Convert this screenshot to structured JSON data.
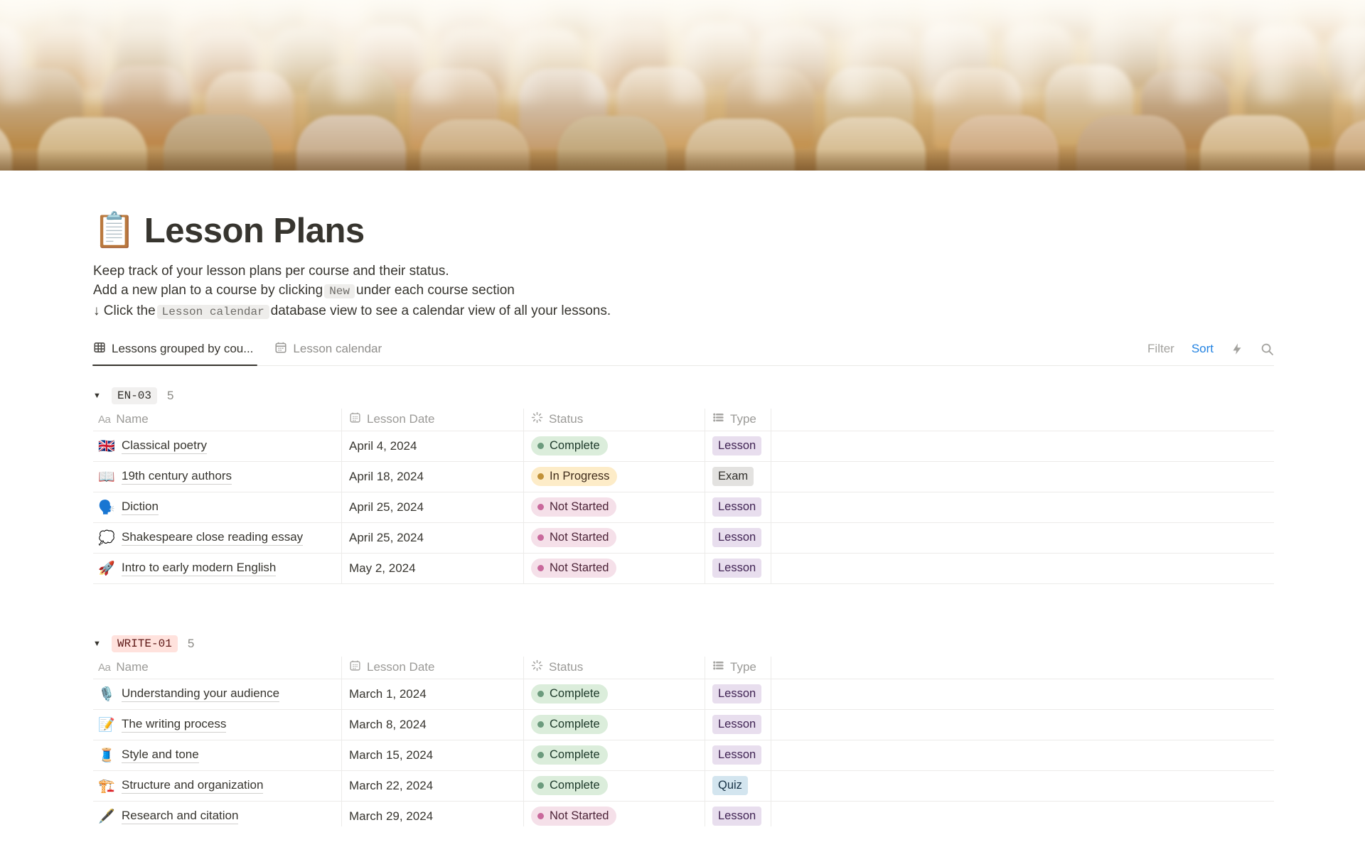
{
  "page": {
    "icon": "📋",
    "icon_name": "clipboard-emoji",
    "title": "Lesson Plans",
    "description_line1": "Keep track of your lesson plans per course and their status.",
    "description_line2_prefix": "Add a new plan to a course by clicking",
    "description_line2_code": "New",
    "description_line2_suffix": "under each course section",
    "description_line3_prefix": "↓ Click the",
    "description_line3_code": "Lesson calendar",
    "description_line3_suffix": "database view to see a calendar view of all your lessons."
  },
  "toolbar": {
    "tabs": [
      {
        "label": "Lessons grouped by cou...",
        "icon": "table-view-icon",
        "active": true
      },
      {
        "label": "Lesson calendar",
        "icon": "calendar-view-icon",
        "active": false
      }
    ],
    "filter_label": "Filter",
    "sort_label": "Sort",
    "sort_color": "#2383E2"
  },
  "table": {
    "columns": [
      {
        "id": "name",
        "label": "Name",
        "icon": "text-property-icon"
      },
      {
        "id": "date",
        "label": "Lesson Date",
        "icon": "calendar-icon"
      },
      {
        "id": "status",
        "label": "Status",
        "icon": "status-property-icon"
      },
      {
        "id": "type",
        "label": "Type",
        "icon": "select-property-icon"
      }
    ]
  },
  "status_colors": {
    "Complete": {
      "bg": "#DBEDDB",
      "dot": "#6C9B7D",
      "text": "#1C3829"
    },
    "In Progress": {
      "bg": "#FDECC8",
      "dot": "#C19138",
      "text": "#402C1B"
    },
    "Not Started": {
      "bg": "#F5E0E9",
      "dot": "#C9699C",
      "text": "#4C2337"
    }
  },
  "type_colors": {
    "Lesson": {
      "bg": "#E8DEEE",
      "text": "#412454"
    },
    "Exam": {
      "bg": "#E3E2E0",
      "text": "#32302C"
    },
    "Quiz": {
      "bg": "#D3E5EF",
      "text": "#183347"
    }
  },
  "groups": [
    {
      "name": "EN-03",
      "count": "5",
      "badge_bg": "#F1F0EF",
      "badge_text_color": "#32302C",
      "rows": [
        {
          "icon": "🇬🇧",
          "icon_name": "uk-flag-emoji",
          "name": "Classical poetry",
          "date": "April 4, 2024",
          "status": "Complete",
          "type": "Lesson"
        },
        {
          "icon": "📖",
          "icon_name": "open-book-emoji",
          "name": "19th century authors",
          "date": "April 18, 2024",
          "status": "In Progress",
          "type": "Exam"
        },
        {
          "icon": "🗣️",
          "icon_name": "speaking-head-emoji",
          "name": "Diction",
          "date": "April 25, 2024",
          "status": "Not Started",
          "type": "Lesson"
        },
        {
          "icon": "💭",
          "icon_name": "thought-balloon-emoji",
          "name": "Shakespeare close reading essay",
          "date": "April 25, 2024",
          "status": "Not Started",
          "type": "Lesson"
        },
        {
          "icon": "🚀",
          "icon_name": "rocket-emoji",
          "name": "Intro to early modern English",
          "date": "May 2, 2024",
          "status": "Not Started",
          "type": "Lesson"
        }
      ]
    },
    {
      "name": "WRITE-01",
      "count": "5",
      "badge_bg": "#FFE2DD",
      "badge_text_color": "#5D1715",
      "rows": [
        {
          "icon": "🎙️",
          "icon_name": "studio-microphone-emoji",
          "name": "Understanding your audience",
          "date": "March 1, 2024",
          "status": "Complete",
          "type": "Lesson"
        },
        {
          "icon": "📝",
          "icon_name": "memo-emoji",
          "name": "The writing process",
          "date": "March 8, 2024",
          "status": "Complete",
          "type": "Lesson"
        },
        {
          "icon": "🧵",
          "icon_name": "thread-emoji",
          "name": "Style and tone",
          "date": "March 15, 2024",
          "status": "Complete",
          "type": "Lesson"
        },
        {
          "icon": "🏗️",
          "icon_name": "building-construction-emoji",
          "name": "Structure and organization",
          "date": "March 22, 2024",
          "status": "Complete",
          "type": "Quiz"
        },
        {
          "icon": "🖋️",
          "icon_name": "fountain-pen-emoji",
          "name": "Research and citation",
          "date": "March 29, 2024",
          "status": "Not Started",
          "type": "Lesson"
        }
      ]
    }
  ]
}
